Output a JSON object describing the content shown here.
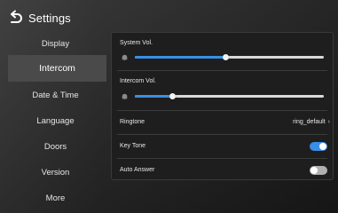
{
  "header": {
    "title": "Settings"
  },
  "sidebar": {
    "items": [
      {
        "label": "Display"
      },
      {
        "label": "Intercom"
      },
      {
        "label": "Date & Time"
      },
      {
        "label": "Language"
      },
      {
        "label": "Doors"
      },
      {
        "label": "Version"
      },
      {
        "label": "More"
      }
    ],
    "active_index": 1
  },
  "panel": {
    "system_vol": {
      "label": "System Vol.",
      "level": 0.48
    },
    "intercom_vol": {
      "label": "Intercom Vol.",
      "level": 0.2
    },
    "ringtone": {
      "label": "Ringtone",
      "value": "ring_default",
      "chevron": "›"
    },
    "key_tone": {
      "label": "Key Tone",
      "on": true
    },
    "auto_answer": {
      "label": "Auto Answer",
      "on": false
    }
  },
  "colors": {
    "accent": "#3a8ee6",
    "toggle_off": "#b0b0b0",
    "active_item_bg": "#4a4a4a",
    "panel_bg": "#1e1e1e"
  },
  "icons": {
    "back": "back-arrow-icon",
    "volume": "bell-icon",
    "chevron": "chevron-right-icon"
  }
}
